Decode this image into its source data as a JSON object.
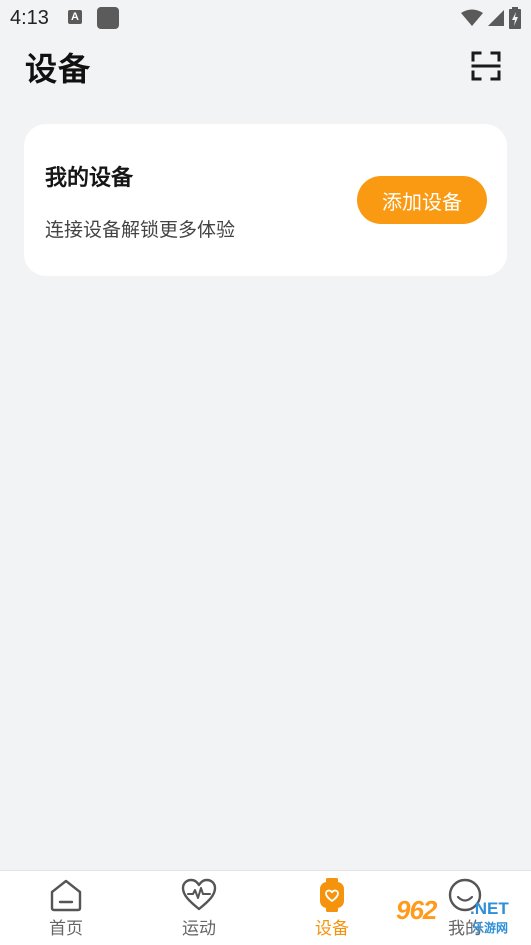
{
  "status_bar": {
    "time": "4:13",
    "notification_icon_letter": "A"
  },
  "header": {
    "title": "设备",
    "scan_icon": "scan-icon"
  },
  "device_card": {
    "title": "我的设备",
    "subtitle": "连接设备解锁更多体验",
    "add_button_label": "添加设备"
  },
  "bottom_nav": {
    "items": [
      {
        "label": "首页",
        "icon": "home-icon",
        "active": false
      },
      {
        "label": "运动",
        "icon": "heart-pulse-icon",
        "active": false
      },
      {
        "label": "设备",
        "icon": "watch-icon",
        "active": true
      },
      {
        "label": "我的",
        "icon": "profile-icon",
        "active": false
      }
    ]
  },
  "watermark": {
    "main": "962",
    "net": ".NET",
    "sub": "乐游网"
  },
  "colors": {
    "accent": "#fa9a12",
    "background": "#f2f3f5",
    "card": "#ffffff",
    "nav_active": "#f5940c",
    "nav_inactive": "#666666"
  }
}
